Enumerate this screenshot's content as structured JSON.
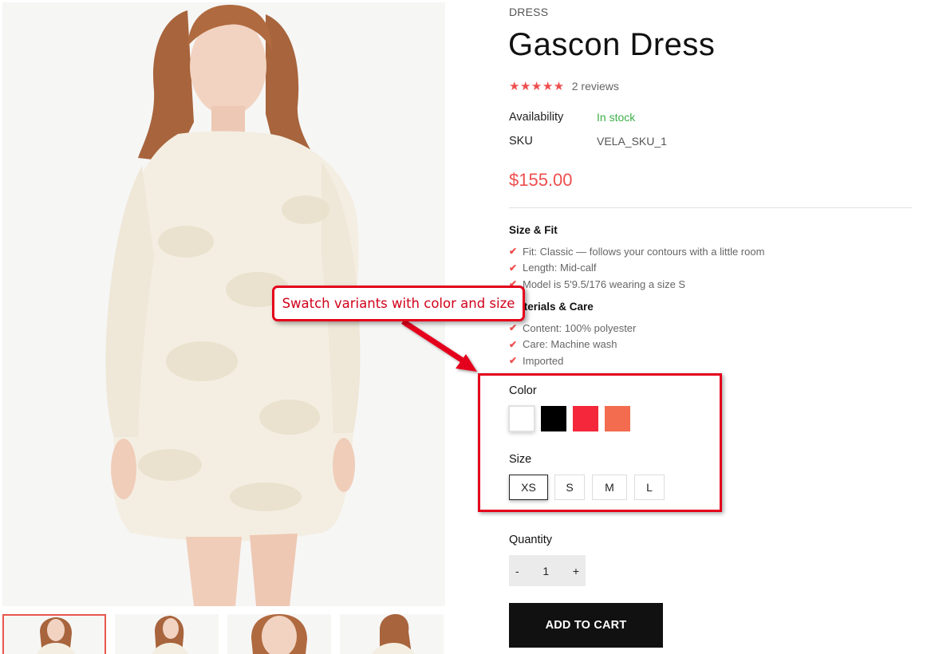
{
  "product": {
    "category": "DRESS",
    "title": "Gascon Dress",
    "rating_stars": "★★★★★",
    "rating_value": 5,
    "reviews": "2 reviews",
    "availability_label": "Availability",
    "availability_value": "In stock",
    "sku_label": "SKU",
    "sku_value": "VELA_SKU_1",
    "price": "$155.00"
  },
  "details": {
    "size_fit_heading": "Size & Fit",
    "size_fit_items": [
      "Fit: Classic — follows your contours with a little room",
      "Length: Mid-calf",
      "Model is 5'9.5/176 wearing a size S"
    ],
    "materials_heading": "Materials & Care",
    "materials_items": [
      "Content: 100% polyester",
      "Care: Machine wash",
      "Imported"
    ]
  },
  "options": {
    "color_label": "Color",
    "colors": [
      {
        "name": "white",
        "hex": "#ffffff",
        "selected": true
      },
      {
        "name": "black",
        "hex": "#000000",
        "selected": false
      },
      {
        "name": "red",
        "hex": "#f4283a",
        "selected": false
      },
      {
        "name": "coral",
        "hex": "#f36c4f",
        "selected": false
      }
    ],
    "size_label": "Size",
    "sizes": [
      {
        "label": "XS",
        "selected": true
      },
      {
        "label": "S",
        "selected": false
      },
      {
        "label": "M",
        "selected": false
      },
      {
        "label": "L",
        "selected": false
      }
    ]
  },
  "quantity": {
    "label": "Quantity",
    "minus": "-",
    "value": "1",
    "plus": "+"
  },
  "cart": {
    "add_to_cart": "ADD TO CART"
  },
  "annotation": {
    "text": "Swatch variants with color and size"
  },
  "colors": {
    "accent": "#ee4e4e",
    "in_stock": "#3cb04a",
    "annotation": "#e4001b",
    "button": "#111111"
  }
}
